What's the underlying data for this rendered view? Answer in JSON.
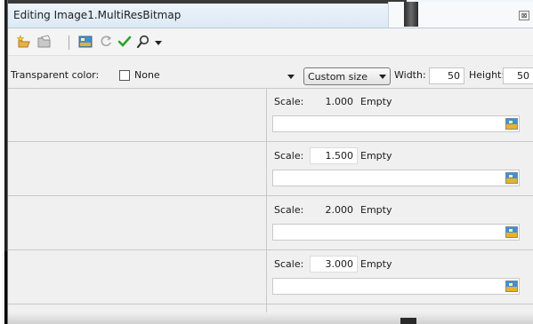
{
  "window": {
    "title": "Editing Image1.MultiResBitmap",
    "close_glyph": "⊠"
  },
  "toolbar": {
    "buttons": [
      {
        "name": "add-new-icon",
        "interactable": true
      },
      {
        "name": "open-folder-icon",
        "interactable": true
      },
      {
        "name": "fill-image-icon",
        "interactable": true
      },
      {
        "name": "refresh-icon",
        "interactable": true
      },
      {
        "name": "checkmark-icon",
        "interactable": true
      },
      {
        "name": "zoom-icon",
        "interactable": true
      }
    ],
    "dropdown_arrow": "▾"
  },
  "options": {
    "transparent_color_label": "Transparent color:",
    "transparent_color_value": "None",
    "size_mode": "Custom size",
    "width_label": "Width:",
    "width_value": "50",
    "height_label": "Height:",
    "height_value": "50"
  },
  "items": [
    {
      "scale_label": "Scale:",
      "scale": "1.000",
      "status": "Empty",
      "readonly": true
    },
    {
      "scale_label": "Scale:",
      "scale": "1.500",
      "status": "Empty",
      "readonly": false
    },
    {
      "scale_label": "Scale:",
      "scale": "2.000",
      "status": "Empty",
      "readonly": true
    },
    {
      "scale_label": "Scale:",
      "scale": "3.000",
      "status": "Empty",
      "readonly": false
    }
  ],
  "colors": {
    "titlebar": "#dce9f5",
    "check_green": "#2ea32e",
    "accent_orange": "#e8a020"
  }
}
